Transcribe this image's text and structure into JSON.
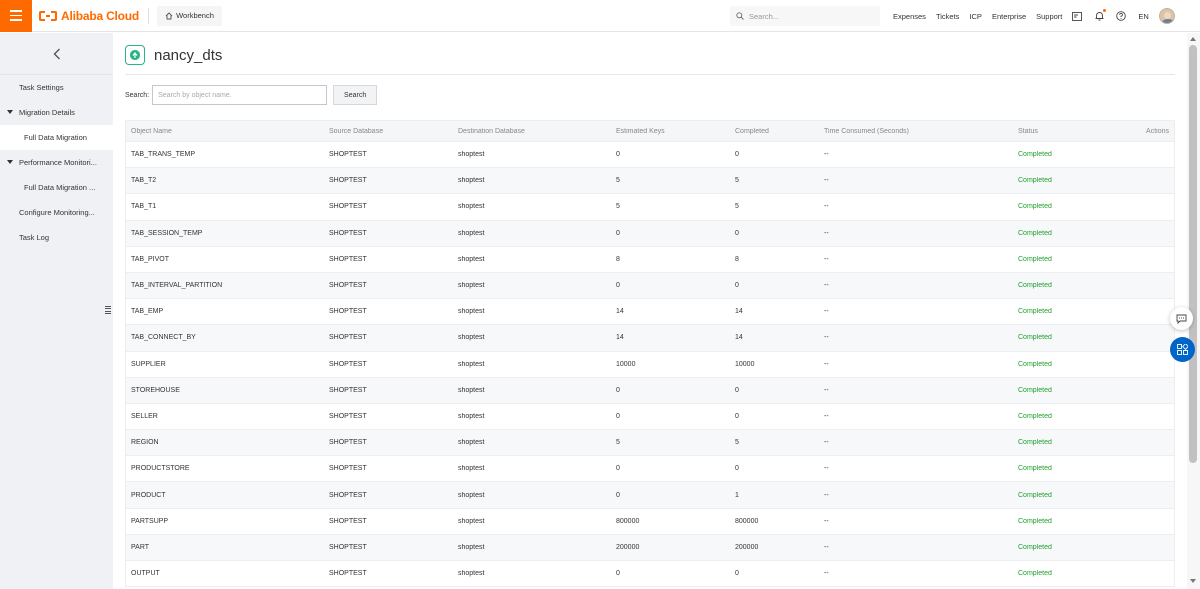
{
  "brand": {
    "name": "Alibaba Cloud",
    "accent": "#ff6a00"
  },
  "topbar": {
    "workbench": "Workbench",
    "search_placeholder": "Search...",
    "nav": [
      "Expenses",
      "Tickets",
      "ICP",
      "Enterprise",
      "Support"
    ],
    "icons": [
      "mail-icon",
      "bell-icon",
      "help-icon"
    ],
    "language": "EN"
  },
  "sidebar": {
    "items": [
      {
        "label": "Task Settings"
      },
      {
        "label": "Migration Details"
      },
      {
        "label": "Full Data Migration"
      },
      {
        "label": "Performance Monitori..."
      },
      {
        "label": "Full Data Migration ..."
      },
      {
        "label": "Configure Monitoring..."
      },
      {
        "label": "Task Log"
      }
    ]
  },
  "task": {
    "title": "nancy_dts"
  },
  "search": {
    "label": "Search:",
    "placeholder": "Search by object name.",
    "button": "Search"
  },
  "table": {
    "headers": [
      "Object Name",
      "Source Database",
      "Destination Database",
      "Estimated Keys",
      "Completed",
      "Time Consumed (Seconds)",
      "Status",
      "Actions"
    ],
    "rows": [
      [
        "TAB_TRANS_TEMP",
        "SHOPTEST",
        "shoptest",
        "0",
        "0",
        "--",
        "Completed"
      ],
      [
        "TAB_T2",
        "SHOPTEST",
        "shoptest",
        "5",
        "5",
        "--",
        "Completed"
      ],
      [
        "TAB_T1",
        "SHOPTEST",
        "shoptest",
        "5",
        "5",
        "--",
        "Completed"
      ],
      [
        "TAB_SESSION_TEMP",
        "SHOPTEST",
        "shoptest",
        "0",
        "0",
        "--",
        "Completed"
      ],
      [
        "TAB_PIVOT",
        "SHOPTEST",
        "shoptest",
        "8",
        "8",
        "--",
        "Completed"
      ],
      [
        "TAB_INTERVAL_PARTITION",
        "SHOPTEST",
        "shoptest",
        "0",
        "0",
        "--",
        "Completed"
      ],
      [
        "TAB_EMP",
        "SHOPTEST",
        "shoptest",
        "14",
        "14",
        "--",
        "Completed"
      ],
      [
        "TAB_CONNECT_BY",
        "SHOPTEST",
        "shoptest",
        "14",
        "14",
        "--",
        "Completed"
      ],
      [
        "SUPPLIER",
        "SHOPTEST",
        "shoptest",
        "10000",
        "10000",
        "--",
        "Completed"
      ],
      [
        "STOREHOUSE",
        "SHOPTEST",
        "shoptest",
        "0",
        "0",
        "--",
        "Completed"
      ],
      [
        "SELLER",
        "SHOPTEST",
        "shoptest",
        "0",
        "0",
        "--",
        "Completed"
      ],
      [
        "REGION",
        "SHOPTEST",
        "shoptest",
        "5",
        "5",
        "--",
        "Completed"
      ],
      [
        "PRODUCTSTORE",
        "SHOPTEST",
        "shoptest",
        "0",
        "0",
        "--",
        "Completed"
      ],
      [
        "PRODUCT",
        "SHOPTEST",
        "shoptest",
        "0",
        "1",
        "--",
        "Completed"
      ],
      [
        "PARTSUPP",
        "SHOPTEST",
        "shoptest",
        "800000",
        "800000",
        "--",
        "Completed"
      ],
      [
        "PART",
        "SHOPTEST",
        "shoptest",
        "200000",
        "200000",
        "--",
        "Completed"
      ],
      [
        "OUTPUT",
        "SHOPTEST",
        "shoptest",
        "0",
        "0",
        "--",
        "Completed"
      ]
    ]
  },
  "colors": {
    "status_completed": "#1e9e2c",
    "apps_button": "#0064c8"
  }
}
